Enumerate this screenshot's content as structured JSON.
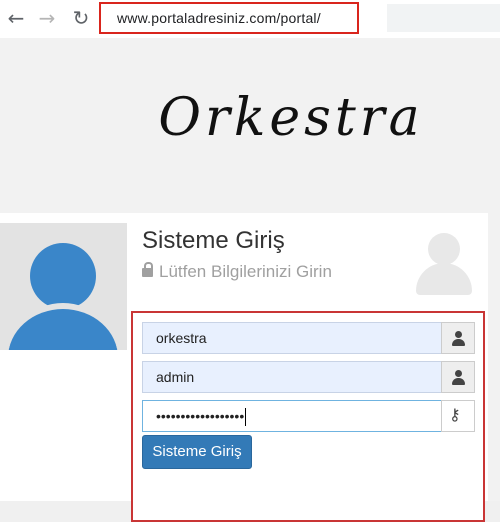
{
  "browser": {
    "url": "www.portaladresiniz.com/portal/",
    "back_icon": "←",
    "forward_icon": "→",
    "reload_icon": "↻"
  },
  "page": {
    "logo_text": "Orkestra",
    "login": {
      "title": "Sisteme Giriş",
      "subtitle": "Lütfen Bilgilerinizi Girin",
      "fields": [
        {
          "name": "company",
          "value": "orkestra"
        },
        {
          "name": "username",
          "value": "admin"
        },
        {
          "name": "password",
          "value": "••••••••••••••••••"
        }
      ],
      "submit_label": "Sisteme Giriş"
    }
  },
  "colors": {
    "accent": "#337ab7",
    "avatar": "#3a86c9",
    "highlight_border": "#d9251d"
  }
}
